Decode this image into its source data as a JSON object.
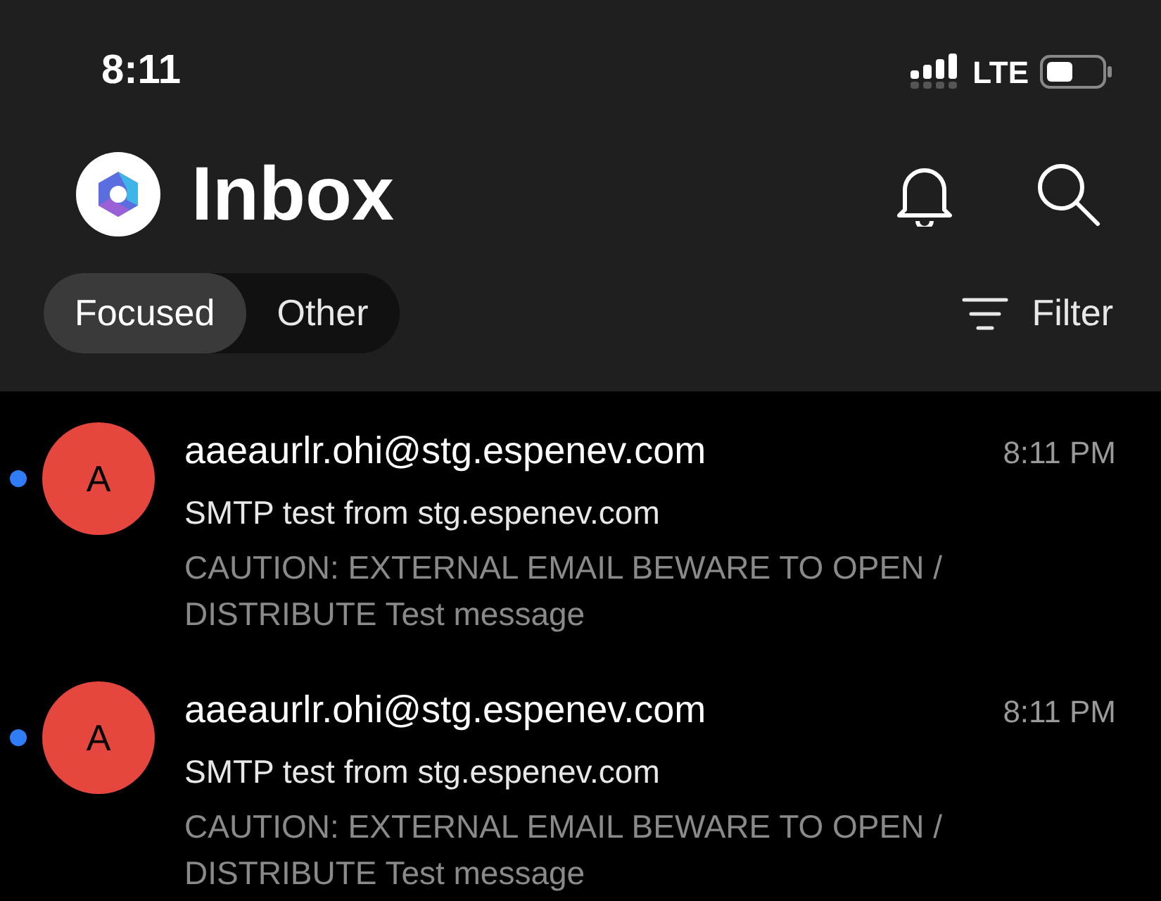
{
  "status_bar": {
    "time": "8:11",
    "network": "LTE"
  },
  "header": {
    "title": "Inbox"
  },
  "tabs": [
    {
      "label": "Focused",
      "selected": true
    },
    {
      "label": "Other",
      "selected": false
    }
  ],
  "filter": {
    "label": "Filter"
  },
  "messages": [
    {
      "unread": true,
      "avatar_letter": "A",
      "color": "#e5463d",
      "sender": "aaeaurlr.ohi@stg.espenev.com",
      "time": "8:11 PM",
      "subject": "SMTP test from stg.espenev.com",
      "preview": "CAUTION: EXTERNAL EMAIL BEWARE TO OPEN / DISTRIBUTE Test message"
    },
    {
      "unread": true,
      "avatar_letter": "A",
      "color": "#e5463d",
      "sender": "aaeaurlr.ohi@stg.espenev.com",
      "time": "8:11 PM",
      "subject": "SMTP test from stg.espenev.com",
      "preview": "CAUTION: EXTERNAL EMAIL BEWARE TO OPEN / DISTRIBUTE Test message"
    }
  ]
}
